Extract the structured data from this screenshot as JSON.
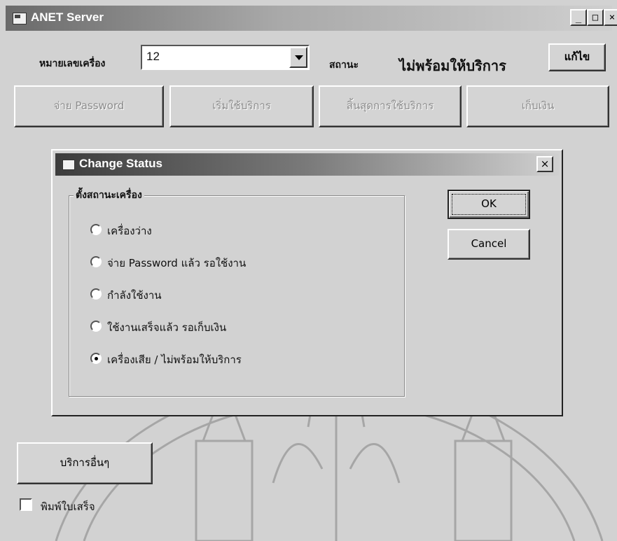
{
  "window": {
    "title": "ANET Server",
    "controls": {
      "minimize": "_",
      "maximize": "□",
      "close": "×"
    }
  },
  "machine": {
    "label": "หมายเลขเครื่อง",
    "selected_value": "12",
    "status_label": "สถานะ",
    "status_value": "ไม่พร้อมให้บริการ",
    "edit_button": "แก้ไข"
  },
  "actions": {
    "give_password": "จ่าย Password",
    "start_service": "เริ่มใช้บริการ",
    "end_service": "สิ้นสุดการใช้บริการ",
    "collect_money": "เก็บเงิน"
  },
  "dialog": {
    "title": "Change Status",
    "close": "×",
    "group_caption": "ตั้งสถานะเครื่อง",
    "options": [
      {
        "label": "เครื่องว่าง",
        "selected": false
      },
      {
        "label": "จ่าย Password แล้ว รอใช้งาน",
        "selected": false
      },
      {
        "label": "กำลังใช้งาน",
        "selected": false
      },
      {
        "label": "ใช้งานเสร็จแล้ว รอเก็บเงิน",
        "selected": false
      },
      {
        "label": "เครื่องเสีย / ไม่พร้อมให้บริการ",
        "selected": true
      }
    ],
    "ok": "OK",
    "cancel": "Cancel"
  },
  "bottom": {
    "other_services": "บริการอื่นๆ",
    "print_receipt": "พิมพ์ใบเสร็จ",
    "print_receipt_checked": false
  },
  "icons": [
    "app-window-icon",
    "dialog-window-icon",
    "dropdown-arrow-icon",
    "watermark-emblem"
  ]
}
